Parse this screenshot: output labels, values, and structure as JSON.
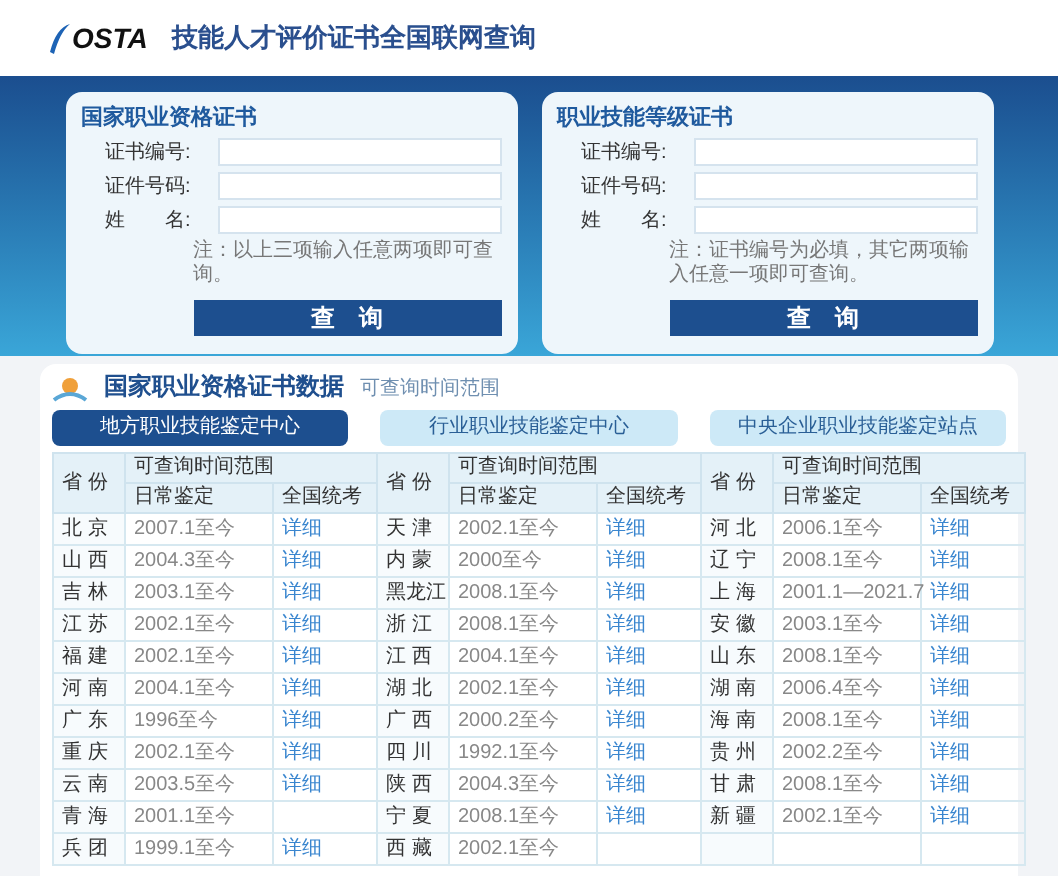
{
  "header": {
    "logo_text": "OSTA",
    "title": "技能人才评价证书全国联网查询"
  },
  "query_cards": [
    {
      "title": "国家职业资格证书",
      "fields": [
        {
          "label": "证书编号:"
        },
        {
          "label": "证件号码:"
        },
        {
          "label": "姓　　名:"
        }
      ],
      "note": "注：以上三项输入任意两项即可查询。",
      "button": "查　询"
    },
    {
      "title": "职业技能等级证书",
      "fields": [
        {
          "label": "证书编号:"
        },
        {
          "label": "证件号码:"
        },
        {
          "label": "姓　　名:"
        }
      ],
      "note": "注：证书编号为必填，其它两项输入任意一项即可查询。",
      "button": "查　询"
    }
  ],
  "data_panel": {
    "title": "国家职业资格证书数据",
    "subtitle": "可查询时间范围",
    "tabs": [
      {
        "label": "地方职业技能鉴定中心",
        "selected": true
      },
      {
        "label": "行业职业技能鉴定中心",
        "selected": false
      },
      {
        "label": "中央企业职业技能鉴定站点",
        "selected": false
      }
    ],
    "table": {
      "columns": [
        {
          "province": "省 份",
          "range": "可查询时间范围",
          "daily": "日常鉴定",
          "exam": "全国统考"
        },
        {
          "province": "省 份",
          "range": "可查询时间范围",
          "daily": "日常鉴定",
          "exam": "全国统考"
        },
        {
          "province": "省 份",
          "range": "可查询时间范围",
          "daily": "日常鉴定",
          "exam": "全国统考"
        }
      ],
      "rows": [
        [
          {
            "province": "北 京",
            "daily": "2007.1至今",
            "exam": "详细"
          },
          {
            "province": "天 津",
            "daily": "2002.1至今",
            "exam": "详细"
          },
          {
            "province": "河 北",
            "daily": "2006.1至今",
            "exam": "详细"
          }
        ],
        [
          {
            "province": "山 西",
            "daily": "2004.3至今",
            "exam": "详细"
          },
          {
            "province": "内 蒙",
            "daily": "2000至今",
            "exam": "详细"
          },
          {
            "province": "辽 宁",
            "daily": "2008.1至今",
            "exam": "详细"
          }
        ],
        [
          {
            "province": "吉 林",
            "daily": "2003.1至今",
            "exam": "详细"
          },
          {
            "province": "黑龙江",
            "daily": "2008.1至今",
            "exam": "详细"
          },
          {
            "province": "上 海",
            "daily": "2001.1—2021.7",
            "exam": "详细"
          }
        ],
        [
          {
            "province": "江 苏",
            "daily": "2002.1至今",
            "exam": "详细"
          },
          {
            "province": "浙 江",
            "daily": "2008.1至今",
            "exam": "详细"
          },
          {
            "province": "安 徽",
            "daily": "2003.1至今",
            "exam": "详细"
          }
        ],
        [
          {
            "province": "福 建",
            "daily": "2002.1至今",
            "exam": "详细"
          },
          {
            "province": "江 西",
            "daily": "2004.1至今",
            "exam": "详细"
          },
          {
            "province": "山 东",
            "daily": "2008.1至今",
            "exam": "详细"
          }
        ],
        [
          {
            "province": "河 南",
            "daily": "2004.1至今",
            "exam": "详细"
          },
          {
            "province": "湖 北",
            "daily": "2002.1至今",
            "exam": "详细"
          },
          {
            "province": "湖 南",
            "daily": "2006.4至今",
            "exam": "详细"
          }
        ],
        [
          {
            "province": "广 东",
            "daily": "1996至今",
            "exam": "详细"
          },
          {
            "province": "广 西",
            "daily": "2000.2至今",
            "exam": "详细"
          },
          {
            "province": "海 南",
            "daily": "2008.1至今",
            "exam": "详细"
          }
        ],
        [
          {
            "province": "重 庆",
            "daily": "2002.1至今",
            "exam": "详细"
          },
          {
            "province": "四 川",
            "daily": "1992.1至今",
            "exam": "详细"
          },
          {
            "province": "贵 州",
            "daily": "2002.2至今",
            "exam": "详细"
          }
        ],
        [
          {
            "province": "云 南",
            "daily": "2003.5至今",
            "exam": "详细"
          },
          {
            "province": "陕 西",
            "daily": "2004.3至今",
            "exam": "详细"
          },
          {
            "province": "甘 肃",
            "daily": "2008.1至今",
            "exam": "详细"
          }
        ],
        [
          {
            "province": "青 海",
            "daily": "2001.1至今"
          },
          {
            "province": "宁 夏",
            "daily": "2008.1至今",
            "exam": "详细"
          },
          {
            "province": "新 疆",
            "daily": "2002.1至今",
            "exam": "详细"
          }
        ],
        [
          {
            "province": "兵 团",
            "daily": "1999.1至今",
            "exam": "详细"
          },
          {
            "province": "西 藏",
            "daily": "2002.1至今"
          },
          {}
        ]
      ]
    }
  }
}
